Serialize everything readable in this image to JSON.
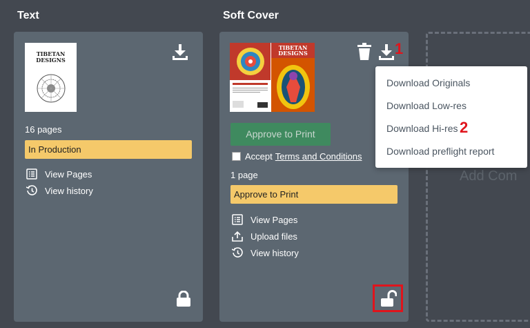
{
  "columns": [
    {
      "title": "Text",
      "thumbnail_text": [
        "TIBETAN",
        "DESIGNS"
      ],
      "pages": "16 pages",
      "status": "In Production",
      "actions": [
        "View Pages",
        "View history"
      ]
    },
    {
      "title": "Soft Cover",
      "thumbnail_text": [
        "TIBETAN",
        "DESIGNS"
      ],
      "approve_button": "Approve to Print",
      "accept_label": "Accept",
      "terms_link": "Terms and Conditions",
      "pages": "1 page",
      "status": "Approve to Print",
      "actions": [
        "View Pages",
        "Upload files",
        "View history"
      ]
    }
  ],
  "dropdown": {
    "items": [
      "Download Originals",
      "Download Low-res",
      "Download Hi-res",
      "Download preflight report"
    ]
  },
  "markers": [
    "1",
    "2"
  ],
  "add_component": "Add Com",
  "colors": {
    "background": "#434850",
    "card": "#5c6771",
    "status_bar": "#f5c96a",
    "approve_button": "#3f8a5f",
    "highlight": "#e0141c"
  }
}
